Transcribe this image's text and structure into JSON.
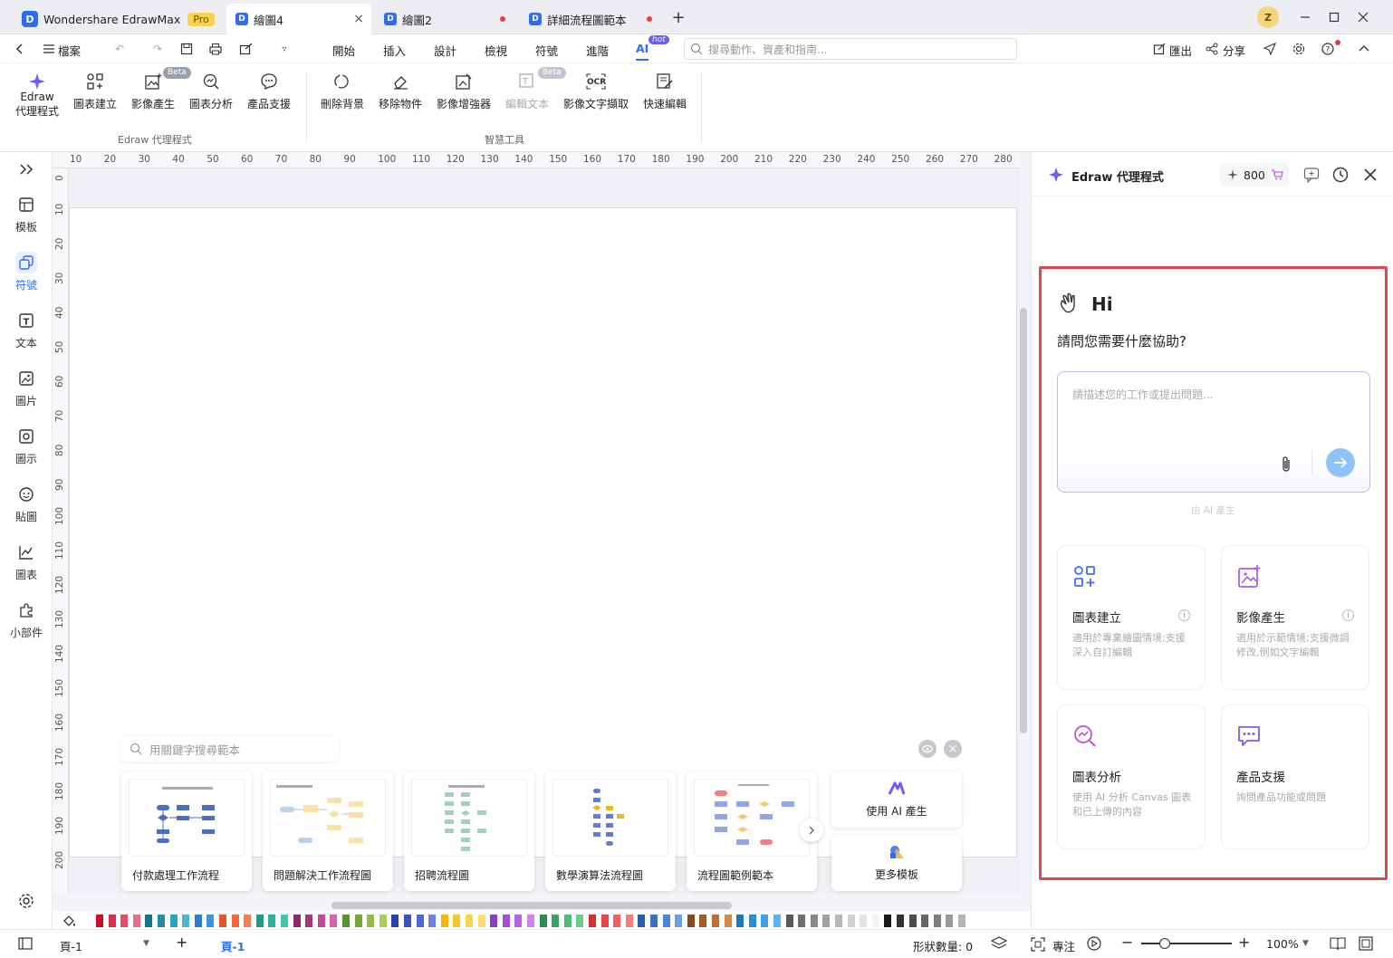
{
  "titlebar": {
    "app_name": "Wondershare EdrawMax",
    "pro_badge": "Pro",
    "tabs": [
      {
        "label": "繪圖4"
      },
      {
        "label": "繪圖2"
      },
      {
        "label": "詳細流程圖範本"
      }
    ],
    "avatar_letter": "Z"
  },
  "menubar": {
    "file_label": "檔案",
    "menus": [
      "開始",
      "插入",
      "設計",
      "檢視",
      "符號",
      "進階",
      "AI"
    ],
    "hot_badge": "hot",
    "search_placeholder": "搜尋動作、資產和指南...",
    "export_label": "匯出",
    "share_label": "分享"
  },
  "ribbon": {
    "agent_line1": "Edraw",
    "agent_line2": "代理程式",
    "items1": [
      "圖表建立",
      "影像產生",
      "圖表分析",
      "產品支援"
    ],
    "beta": "Beta",
    "group1": "Edraw 代理程式",
    "items2": [
      "刪除背景",
      "移除物件",
      "影像增強器",
      "編輯文本",
      "影像文字擷取",
      "快速編輯"
    ],
    "group2": "智慧工具"
  },
  "leftbar": {
    "items": [
      "模板",
      "符號",
      "文本",
      "圖片",
      "圖示",
      "貼圖",
      "圖表",
      "小部件"
    ]
  },
  "ruler": {
    "h": [
      "10",
      "20",
      "30",
      "40",
      "50",
      "60",
      "70",
      "80",
      "90",
      "100",
      "110",
      "120",
      "130",
      "140",
      "150",
      "160",
      "170",
      "180",
      "190",
      "200",
      "210",
      "220",
      "230",
      "240",
      "250",
      "260",
      "270",
      "280"
    ],
    "v": [
      "0",
      "10",
      "20",
      "30",
      "40",
      "50",
      "60",
      "70",
      "80",
      "90",
      "100",
      "110",
      "120",
      "130",
      "140",
      "150",
      "160",
      "170",
      "180",
      "190",
      "200"
    ]
  },
  "templates": {
    "search_placeholder": "用關鍵字搜尋範本",
    "cards": [
      {
        "label": "付款處理工作流程"
      },
      {
        "label": "問題解決工作流程圖"
      },
      {
        "label": "招聘流程圖"
      },
      {
        "label": "數學演算法流程圖"
      },
      {
        "label": "流程圖範例範本"
      }
    ],
    "ai_generate": "使用 AI 產生",
    "more": "更多模板"
  },
  "status": {
    "page_selector": "頁-1",
    "page_tab": "頁-1",
    "shape_count": "形狀數量: 0",
    "focus": "專注",
    "zoom": "100%"
  },
  "panel": {
    "title": "Edraw 代理程式",
    "credits": "800",
    "hi": "Hi",
    "question": "請問您需要什麼協助?",
    "input_placeholder": "請描述您的工作或提出問題...",
    "ai_note": "由 AI 產生",
    "features": [
      {
        "title": "圖表建立",
        "desc": "適用於專業繪圖情境;支援深入自訂編輯"
      },
      {
        "title": "影像產生",
        "desc": "適用於示範情境;支援微調修改,例如文字編輯"
      },
      {
        "title": "圖表分析",
        "desc": "使用 AI 分析 Canvas 圖表和已上傳的內容"
      },
      {
        "title": "產品支援",
        "desc": "詢問產品功能或問題"
      }
    ]
  },
  "colors": {
    "accent": "#2f6cf6",
    "highlight": "#e0484f"
  }
}
